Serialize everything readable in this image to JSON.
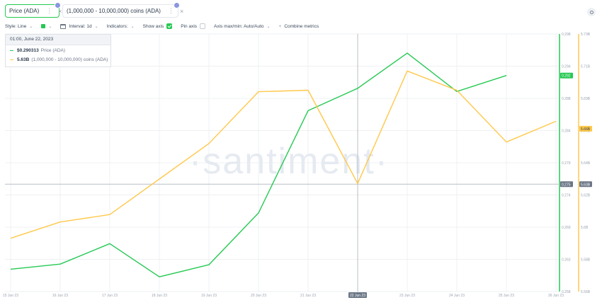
{
  "metrics": [
    {
      "label": "Price (ADA)",
      "color": "#26c953",
      "selected": true
    },
    {
      "label": "(1,000,000 - 10,000,000) coins (ADA)",
      "color": "#ffc84a",
      "selected": false
    }
  ],
  "toolbar": {
    "style_label": "Style: Line",
    "interval_label": "Interval: 1d",
    "indicators_label": "Indicators:",
    "show_axis_label": "Show axis",
    "pin_axis_label": "Pin axis",
    "axis_maxmin_label": "Axis max/min: Auto/Auto",
    "combine_label": "Combine metrics"
  },
  "tooltip": {
    "date": "01:00, June 22, 2023",
    "rows": [
      {
        "value": "$0.290313",
        "name": "Price (ADA)",
        "color": "#26c953"
      },
      {
        "value": "5.63B",
        "name": "(1,000,000 - 10,000,000) coins (ADA)",
        "color": "#ffc84a"
      }
    ]
  },
  "watermark": "·santiment·",
  "chart_data": {
    "type": "line",
    "categories": [
      "15 Jun 23",
      "16 Jun 23",
      "17 Jun 23",
      "18 Jun 23",
      "19 Jun 23",
      "20 Jun 23",
      "21 Jun 23",
      "22 Jun 23",
      "23 Jun 23",
      "24 Jun 23",
      "25 Jun 23",
      "26 Jun 23"
    ],
    "series": [
      {
        "name": "Price (ADA)",
        "axis": "left",
        "color": "#26c953",
        "values": [
          0.2617,
          0.2625,
          0.2657,
          0.2605,
          0.2624,
          0.2705,
          0.2865,
          0.29,
          0.2955,
          0.2895,
          0.292,
          null
        ]
      },
      {
        "name": "(1,000,000 - 10,000,000) coins (ADA)",
        "axis": "right",
        "color": "#ffc84a",
        "values": [
          5.594,
          5.605,
          5.61,
          5.634,
          5.658,
          5.693,
          5.694,
          5.631,
          5.707,
          5.694,
          5.659,
          5.673
        ]
      }
    ],
    "left_axis": {
      "ticks": [
        "0.298",
        "0.294",
        "0.288",
        "0.284",
        "0.279",
        "0.274",
        "0.269",
        "0.263",
        "0.258"
      ],
      "min": 0.2582,
      "max": 0.2985
    },
    "right_axis": {
      "ticks": [
        "5.73B",
        "5.71B",
        "5.69B",
        "5.66B",
        "5.64B",
        "5.62B",
        "5.6B",
        "5.58B",
        "5.56B"
      ],
      "min": 5.558,
      "max": 5.732
    },
    "current_values": {
      "left": "0.292",
      "right": "5.66B"
    },
    "crosshair": {
      "date": "22 Jun 23",
      "left_value": "0.275",
      "right_value": "5.63B"
    },
    "grid": true
  }
}
